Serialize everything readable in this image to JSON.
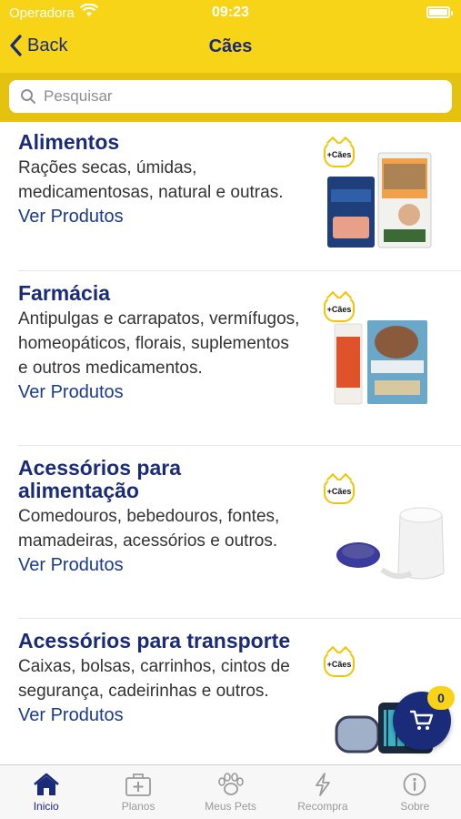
{
  "status": {
    "carrier": "Operadora",
    "time": "09:23"
  },
  "nav": {
    "back_label": "Back",
    "title": "Cães"
  },
  "search": {
    "placeholder": "Pesquisar"
  },
  "categories": [
    {
      "title": "Alimentos",
      "description": "Rações secas, úmidas, medicamentosas, natural e outras.",
      "link": "Ver Produtos",
      "tag": "+Cães"
    },
    {
      "title": "Farmácia",
      "description": "Antipulgas e carrapatos, vermífugos, homeopáticos, florais, suplementos e outros medicamentos.",
      "link": "Ver Produtos",
      "tag": "+Cães"
    },
    {
      "title": "Acessórios para alimentação",
      "description": "Comedouros, bebedouros, fontes, mamadeiras, acessórios e outros.",
      "link": "Ver Produtos",
      "tag": "+Cães"
    },
    {
      "title": "Acessórios para transporte",
      "description": "Caixas, bolsas, carrinhos, cintos de segurança, cadeirinhas e outros.",
      "link": "Ver Produtos",
      "tag": "+Cães"
    }
  ],
  "cart": {
    "count": "0"
  },
  "tabs": [
    {
      "label": "Inicio",
      "icon": "home-icon",
      "active": true
    },
    {
      "label": "Planos",
      "icon": "medical-kit-icon",
      "active": false
    },
    {
      "label": "Meus Pets",
      "icon": "paw-icon",
      "active": false
    },
    {
      "label": "Recompra",
      "icon": "lightning-icon",
      "active": false
    },
    {
      "label": "Sobre",
      "icon": "info-icon",
      "active": false
    }
  ],
  "colors": {
    "primary": "#1a2b7a",
    "accent": "#f7d417",
    "tab_inactive": "#9a9a9a"
  }
}
